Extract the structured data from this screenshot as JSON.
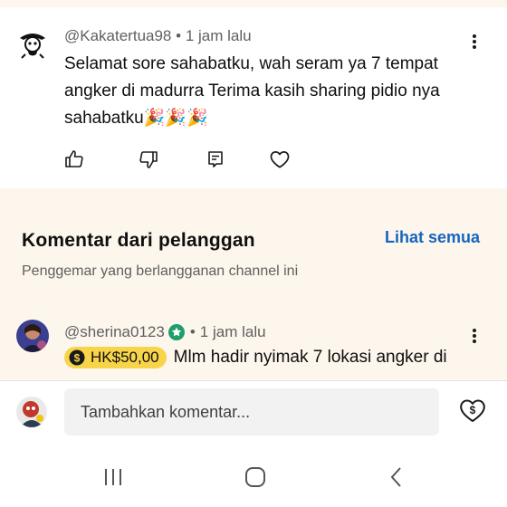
{
  "comment1": {
    "author": "@Kakatertua98",
    "time": "1 jam lalu",
    "text": "Selamat sore sahabatku, wah seram ya 7 tempat angker di madurra Terima kasih sharing pidio nya sahabatku🎉🎉🎉"
  },
  "subscribers": {
    "title": "Komentar dari pelanggan",
    "see_all": "Lihat semua",
    "subtitle": "Penggemar yang berlangganan channel ini"
  },
  "comment2": {
    "author": "@sherina0123",
    "time": "1 jam lalu",
    "super_thanks_amount": "HK$50,00",
    "text": "Mlm hadir nyimak 7 lokasi angker di"
  },
  "composer": {
    "placeholder": "Tambahkan komentar..."
  },
  "separator": "•",
  "colors": {
    "section_bg": "#fdf6ec",
    "link": "#1565c0",
    "super_thanks": "#f8d44a",
    "verified": "#1e9e6a"
  },
  "icons": {
    "like": "thumbs-up-icon",
    "dislike": "thumbs-down-icon",
    "reply": "reply-icon",
    "heart": "heart-icon",
    "more": "kebab-menu-icon",
    "super_thanks": "super-thanks-icon",
    "verified": "verified-badge-icon"
  }
}
